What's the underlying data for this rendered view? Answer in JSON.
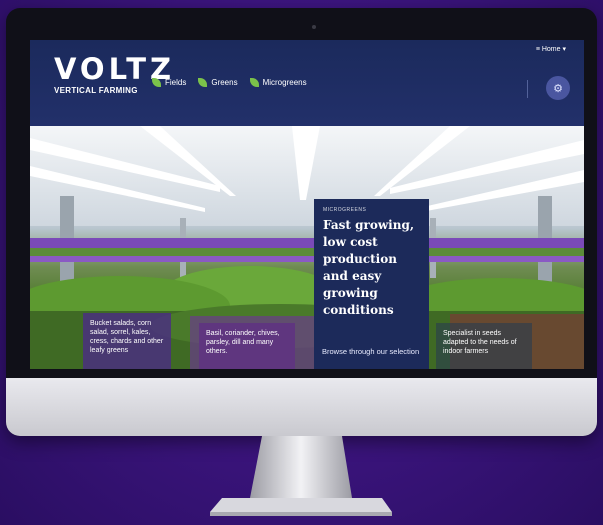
{
  "header": {
    "logo_main": "VOLTZ",
    "logo_sub": "VERTICAL FARMING",
    "nav": [
      {
        "label": "Fields",
        "icon": "leaf-icon"
      },
      {
        "label": "Greens",
        "icon": "leaf-icon"
      },
      {
        "label": "Microgreens",
        "icon": "leaf-icon"
      }
    ],
    "lang_button": "≡ Home ▾",
    "user_icon": "gear-icon"
  },
  "featured": {
    "tag": "MICROGREENS",
    "title": "Fast growing, low cost production and easy growing conditions",
    "link": "Browse through our selection"
  },
  "cards": {
    "salads": "Bucket salads, corn salad, sorrel, kales, cress, chards and other leafy greens",
    "basil": "Basil, coriander, chives, parsley, dill and many others.",
    "specialist": "Specialist in seeds adapted to the needs of indoor farmers"
  },
  "colors": {
    "brand_navy": "#1c2a5a",
    "accent_green": "#7bc24a",
    "card_purple": "#4b2d82"
  }
}
